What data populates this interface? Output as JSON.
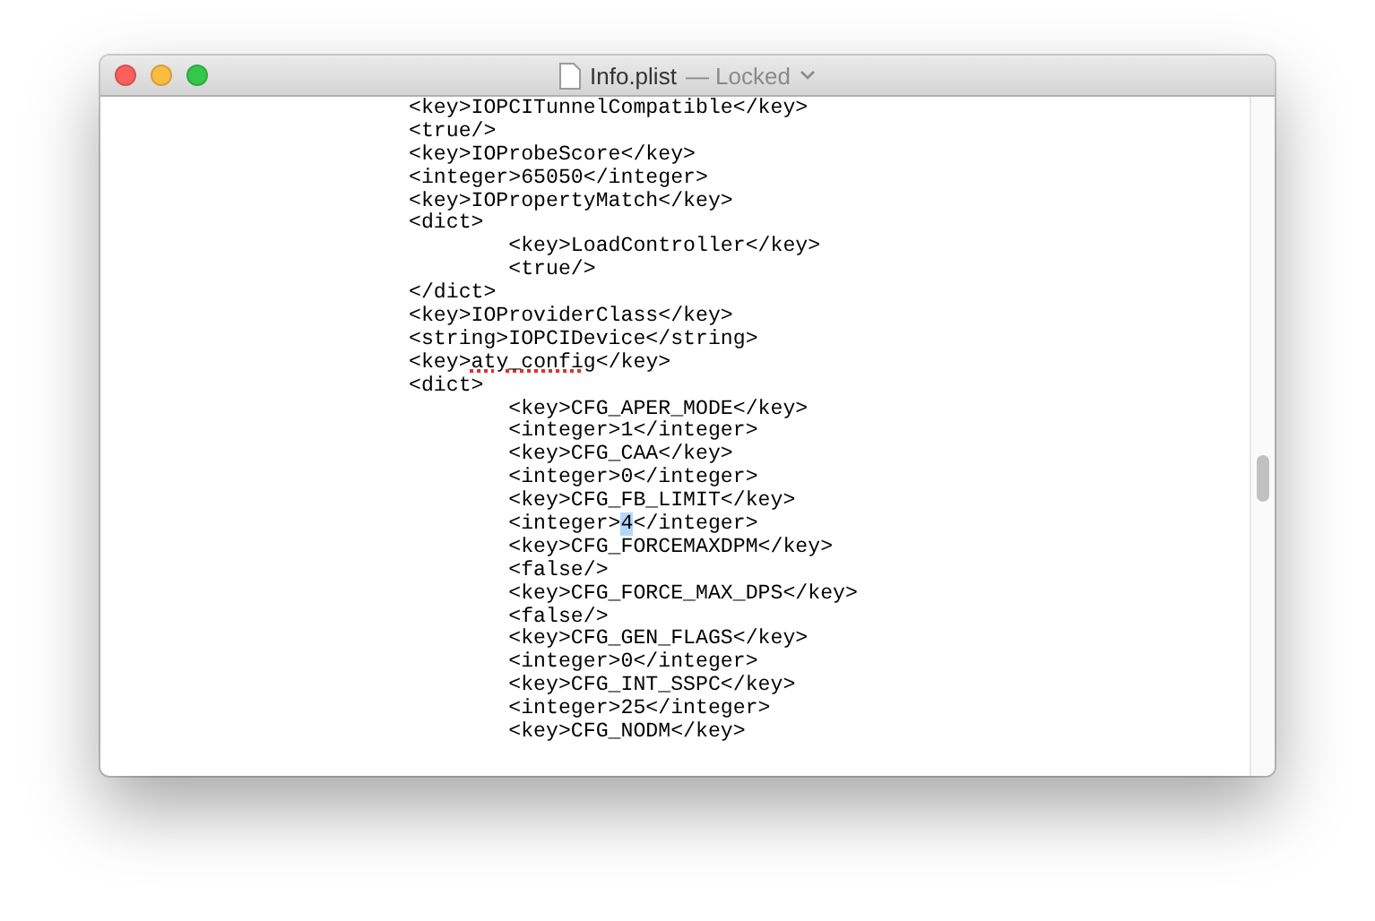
{
  "window": {
    "title": "Info.plist",
    "status": "— Locked"
  },
  "editor": {
    "lines": [
      {
        "segments": [
          {
            "text": "\t\t\t<key>IOPCITunnelCompatible</key>",
            "kind": "plain"
          }
        ]
      },
      {
        "segments": [
          {
            "text": "\t\t\t<true/>",
            "kind": "plain"
          }
        ]
      },
      {
        "segments": [
          {
            "text": "\t\t\t<key>IOProbeScore</key>",
            "kind": "plain"
          }
        ]
      },
      {
        "segments": [
          {
            "text": "\t\t\t<integer>65050</integer>",
            "kind": "plain"
          }
        ]
      },
      {
        "segments": [
          {
            "text": "\t\t\t<key>IOPropertyMatch</key>",
            "kind": "plain"
          }
        ]
      },
      {
        "segments": [
          {
            "text": "\t\t\t<dict>",
            "kind": "plain"
          }
        ]
      },
      {
        "segments": [
          {
            "text": "\t\t\t\t<key>LoadController</key>",
            "kind": "plain"
          }
        ]
      },
      {
        "segments": [
          {
            "text": "\t\t\t\t<true/>",
            "kind": "plain"
          }
        ]
      },
      {
        "segments": [
          {
            "text": "\t\t\t</dict>",
            "kind": "plain"
          }
        ]
      },
      {
        "segments": [
          {
            "text": "\t\t\t<key>IOProviderClass</key>",
            "kind": "plain"
          }
        ]
      },
      {
        "segments": [
          {
            "text": "\t\t\t<string>IOPCIDevice</string>",
            "kind": "plain"
          }
        ]
      },
      {
        "segments": [
          {
            "text": "\t\t\t<key>",
            "kind": "plain"
          },
          {
            "text": "aty_config",
            "kind": "misspelled"
          },
          {
            "text": "</key>",
            "kind": "plain"
          }
        ]
      },
      {
        "segments": [
          {
            "text": "\t\t\t<dict>",
            "kind": "plain"
          }
        ]
      },
      {
        "segments": [
          {
            "text": "\t\t\t\t<key>CFG_APER_MODE</key>",
            "kind": "plain"
          }
        ]
      },
      {
        "segments": [
          {
            "text": "\t\t\t\t<integer>1</integer>",
            "kind": "plain"
          }
        ]
      },
      {
        "segments": [
          {
            "text": "\t\t\t\t<key>CFG_CAA</key>",
            "kind": "plain"
          }
        ]
      },
      {
        "segments": [
          {
            "text": "\t\t\t\t<integer>0</integer>",
            "kind": "plain"
          }
        ]
      },
      {
        "segments": [
          {
            "text": "\t\t\t\t<key>CFG_FB_LIMIT</key>",
            "kind": "plain"
          }
        ]
      },
      {
        "segments": [
          {
            "text": "\t\t\t\t<integer>",
            "kind": "plain"
          },
          {
            "text": "4",
            "kind": "selected"
          },
          {
            "text": "</integer>",
            "kind": "plain"
          }
        ]
      },
      {
        "segments": [
          {
            "text": "\t\t\t\t<key>CFG_FORCEMAXDPM</key>",
            "kind": "plain"
          }
        ]
      },
      {
        "segments": [
          {
            "text": "\t\t\t\t<false/>",
            "kind": "plain"
          }
        ]
      },
      {
        "segments": [
          {
            "text": "\t\t\t\t<key>CFG_FORCE_MAX_DPS</key>",
            "kind": "plain"
          }
        ]
      },
      {
        "segments": [
          {
            "text": "\t\t\t\t<false/>",
            "kind": "plain"
          }
        ]
      },
      {
        "segments": [
          {
            "text": "\t\t\t\t<key>CFG_GEN_FLAGS</key>",
            "kind": "plain"
          }
        ]
      },
      {
        "segments": [
          {
            "text": "\t\t\t\t<integer>0</integer>",
            "kind": "plain"
          }
        ]
      },
      {
        "segments": [
          {
            "text": "\t\t\t\t<key>CFG_INT_SSPC</key>",
            "kind": "plain"
          }
        ]
      },
      {
        "segments": [
          {
            "text": "\t\t\t\t<integer>25</integer>",
            "kind": "plain"
          }
        ]
      },
      {
        "segments": [
          {
            "text": "\t\t\t\t<key>CFG_NODM</key>",
            "kind": "plain"
          }
        ]
      }
    ]
  }
}
